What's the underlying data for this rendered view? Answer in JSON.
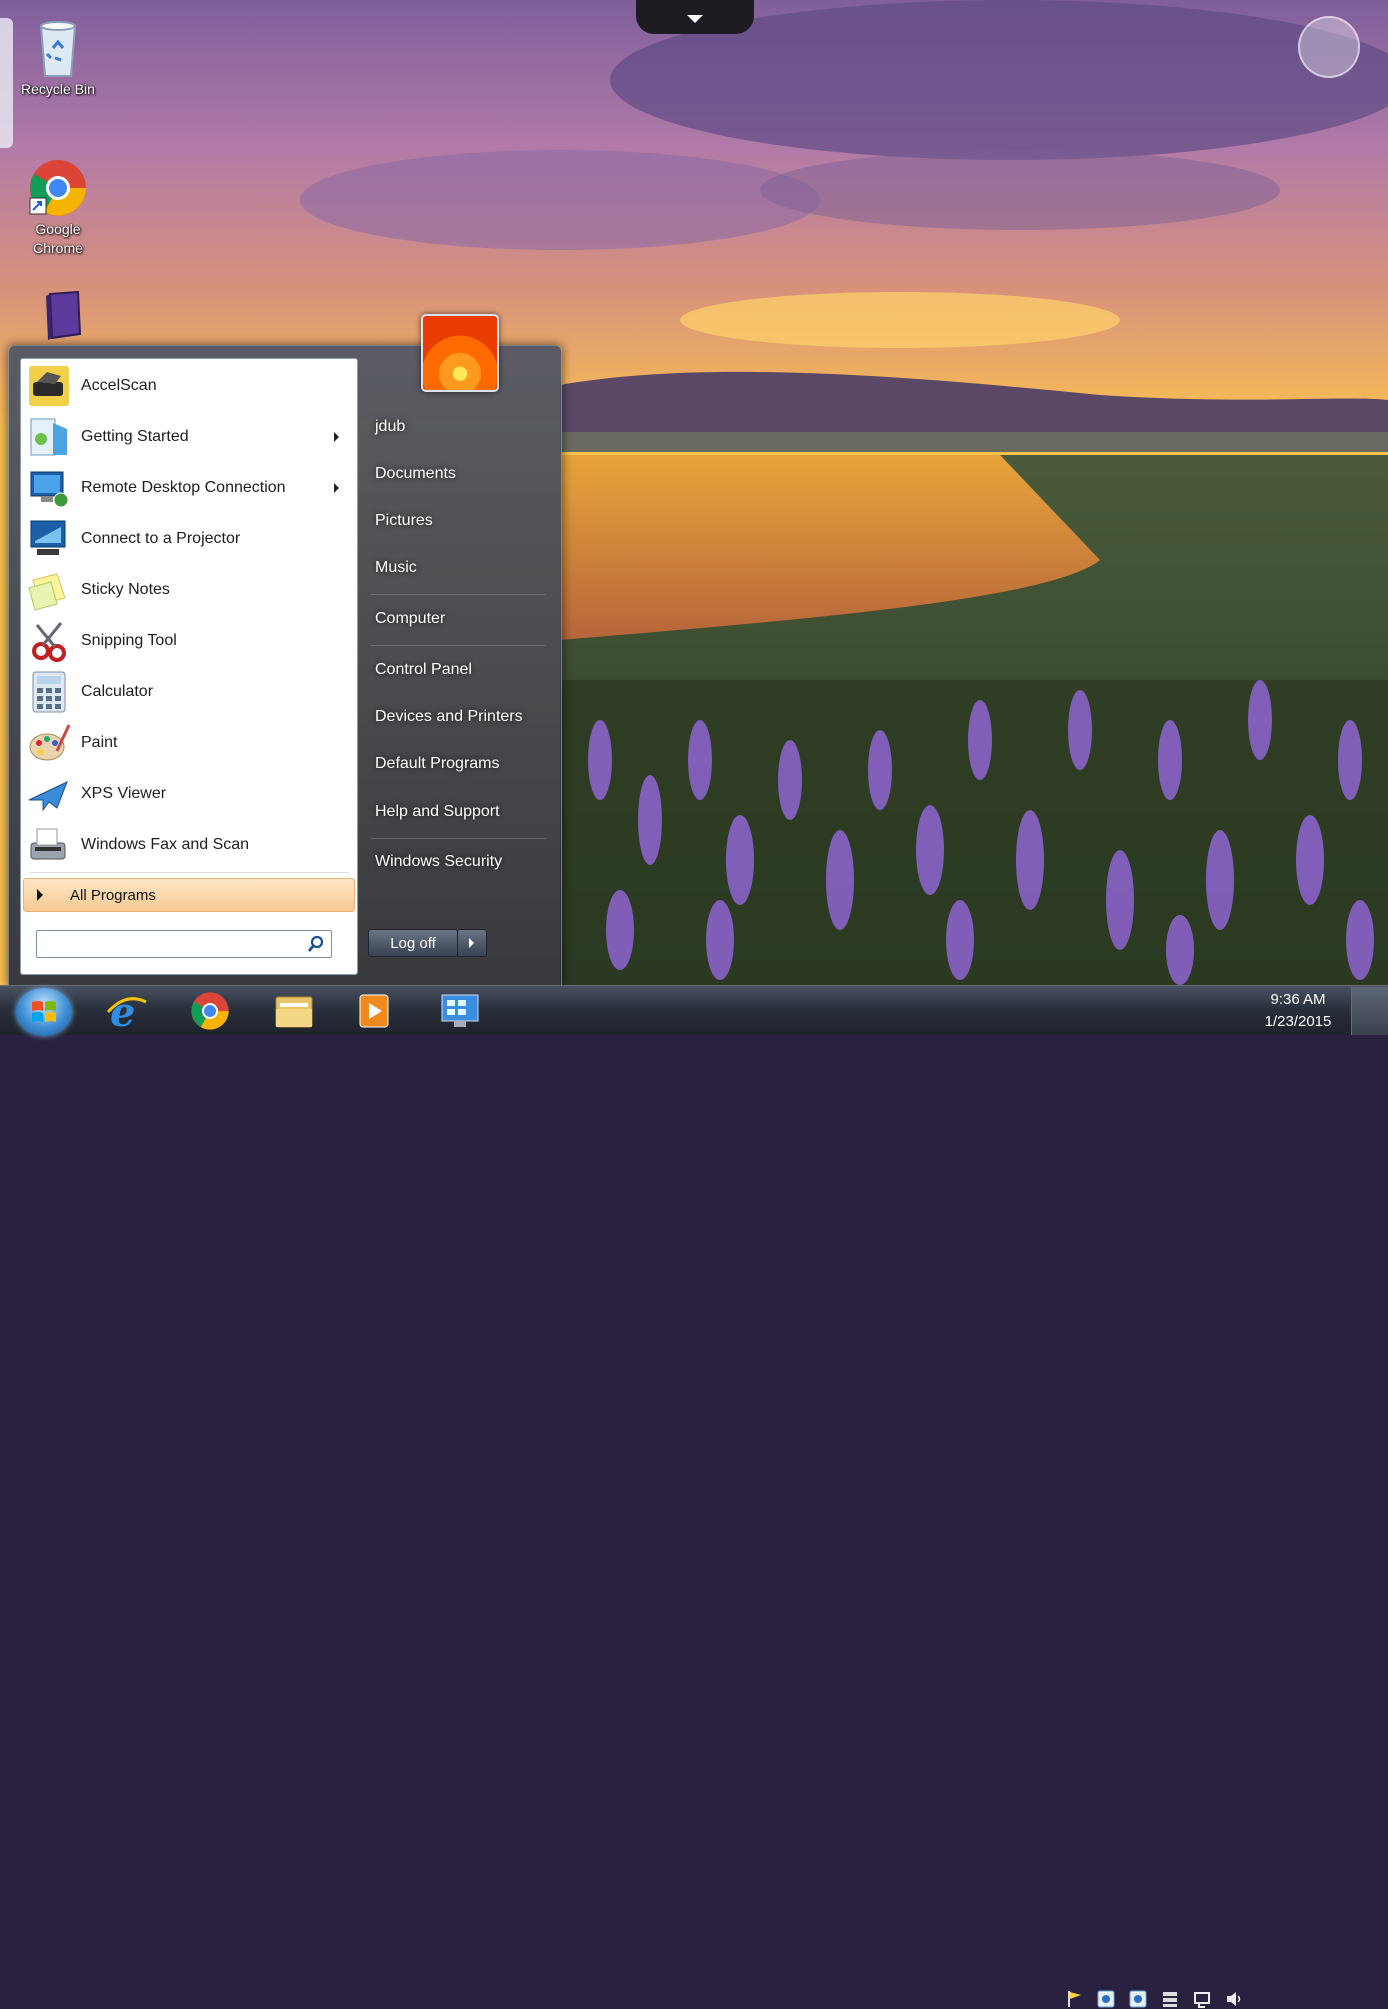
{
  "desktop": {
    "icons": [
      {
        "name": "recycle-bin",
        "label": "Recycle Bin"
      },
      {
        "name": "google-chrome",
        "label": "Google Chrome"
      }
    ]
  },
  "start_menu": {
    "programs": [
      {
        "label": "AccelScan",
        "icon": "scanner-icon",
        "submenu": false
      },
      {
        "label": "Getting Started",
        "icon": "getting-started-icon",
        "submenu": true
      },
      {
        "label": "Remote Desktop Connection",
        "icon": "remote-desktop-icon",
        "submenu": true
      },
      {
        "label": "Connect to a Projector",
        "icon": "projector-icon",
        "submenu": false
      },
      {
        "label": "Sticky Notes",
        "icon": "sticky-notes-icon",
        "submenu": false
      },
      {
        "label": "Snipping Tool",
        "icon": "scissors-icon",
        "submenu": false
      },
      {
        "label": "Calculator",
        "icon": "calculator-icon",
        "submenu": false
      },
      {
        "label": "Paint",
        "icon": "paint-palette-icon",
        "submenu": false
      },
      {
        "label": "XPS Viewer",
        "icon": "xps-viewer-icon",
        "submenu": false
      },
      {
        "label": "Windows Fax and Scan",
        "icon": "fax-icon",
        "submenu": false
      }
    ],
    "all_programs_label": "All Programs",
    "search_placeholder": "",
    "right_items": [
      {
        "label": "jdub"
      },
      {
        "label": "Documents"
      },
      {
        "label": "Pictures"
      },
      {
        "label": "Music"
      },
      {
        "label": "Computer"
      },
      {
        "label": "Control Panel"
      },
      {
        "label": "Devices and Printers"
      },
      {
        "label": "Default Programs"
      },
      {
        "label": "Help and Support"
      },
      {
        "label": "Windows Security"
      }
    ],
    "logoff_label": "Log off"
  },
  "taskbar": {
    "pinned": [
      "internet-explorer-icon",
      "chrome-icon",
      "file-explorer-icon",
      "media-player-icon",
      "remote-desktop-icon"
    ],
    "tray_icons": [
      "flag-icon",
      "network-icon",
      "network-icon",
      "server-icon",
      "notification-icon",
      "speaker-icon"
    ],
    "clock_time": "9:36 AM",
    "clock_date": "1/23/2015"
  },
  "colors": {
    "menu_highlight": "#f7c993",
    "taskbar": "#2a303c",
    "accent": "#3f8ed6"
  }
}
